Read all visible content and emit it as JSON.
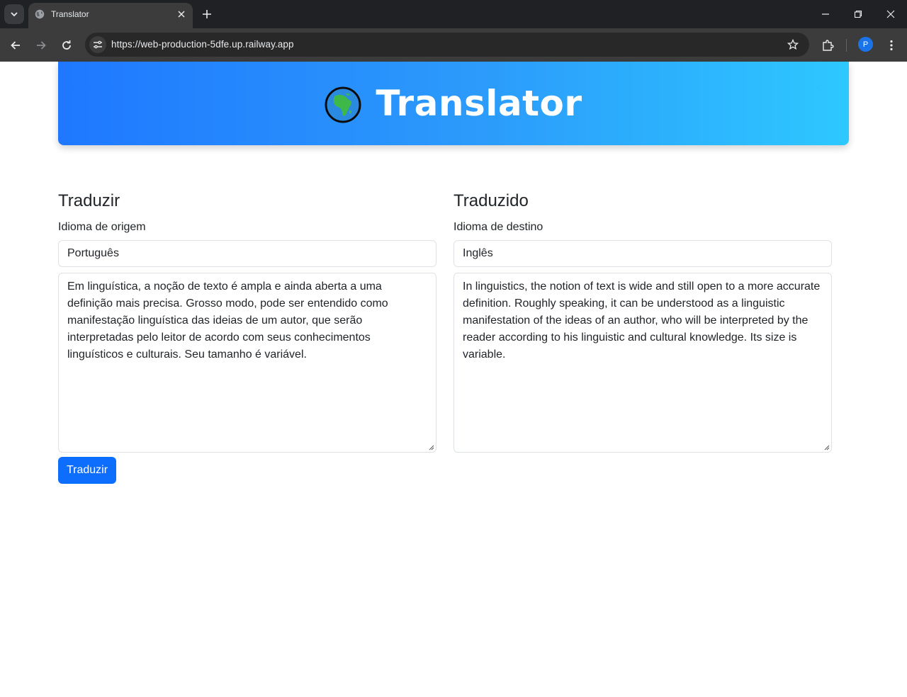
{
  "browser": {
    "tab_title": "Translator",
    "url": "https://web-production-5dfe.up.railway.app",
    "profile_initial": "P"
  },
  "header": {
    "icon": "globe-africa-icon",
    "title": "Translator"
  },
  "source": {
    "heading": "Traduzir",
    "language_label": "Idioma de origem",
    "language_value": "Português",
    "text": "Em linguística, a noção de texto é ampla e ainda aberta a uma definição mais precisa. Grosso modo, pode ser entendido como manifestação linguística das ideias de um autor, que serão interpretadas pelo leitor de acordo com seus conhecimentos linguísticos e culturais. Seu tamanho é variável."
  },
  "target": {
    "heading": "Traduzido",
    "language_label": "Idioma de destino",
    "language_value": "Inglês",
    "text": "In linguistics, the notion of text is wide and still open to a more accurate definition. Roughly speaking, it can be understood as a linguistic manifestation of the ideas of an author, who will be interpreted by the reader according to his linguistic and cultural knowledge. Its size is variable."
  },
  "actions": {
    "translate_label": "Traduzir"
  },
  "colors": {
    "header_gradient_start": "#1f78ff",
    "header_gradient_end": "#2dc8ff",
    "primary_button": "#0d6efd"
  }
}
